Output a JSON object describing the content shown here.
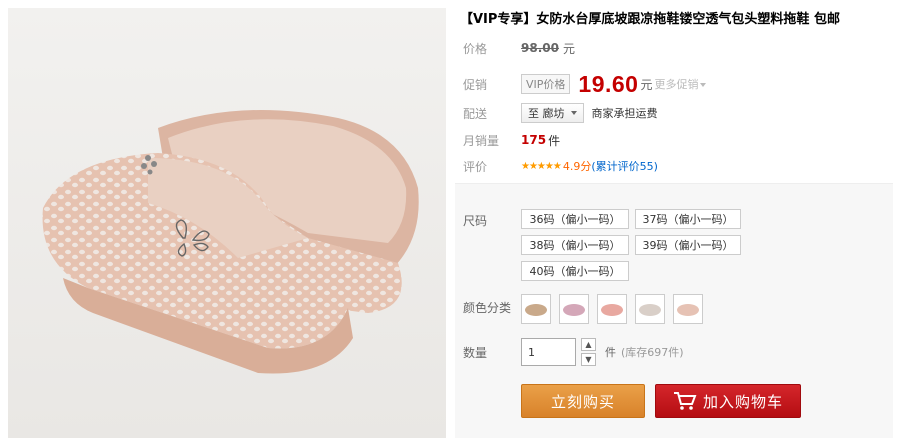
{
  "product": {
    "title": "【VIP专享】女防水台厚底坡跟凉拖鞋镂空透气包头塑料拖鞋 包邮"
  },
  "price": {
    "label": "价格",
    "original": "98.00",
    "currency": "元"
  },
  "promo": {
    "label": "促销",
    "vip_tag": "VIP价格",
    "price": "19.60",
    "currency": "元",
    "more": "更多促销"
  },
  "delivery": {
    "label": "配送",
    "destination": "至 廊坊",
    "note": "商家承担运费"
  },
  "sales": {
    "label": "月销量",
    "count": "175",
    "unit": "件"
  },
  "rating": {
    "label": "评价",
    "stars": "★★★★★",
    "score": "4.9分",
    "link": "(累计评价55)"
  },
  "options": {
    "size_label": "尺码",
    "sizes": [
      "36码（偏小一码）",
      "37码（偏小一码）",
      "38码（偏小一码）",
      "39码（偏小一码）",
      "40码（偏小一码）"
    ],
    "color_label": "颜色分类",
    "color_swatches": [
      "#c9a98a",
      "#d4a7b8",
      "#e8a8a0",
      "#d9cfc8",
      "#e6c2b4"
    ],
    "quantity_label": "数量",
    "quantity_value": "1",
    "quantity_unit": "件",
    "stock": "(库存697件)"
  },
  "actions": {
    "buy_now": "立刻购买",
    "add_to_cart": "加入购物车"
  },
  "colors": {
    "price_red": "#c40000",
    "buy_orange": "#d8822a",
    "cart_red": "#c0161b"
  }
}
